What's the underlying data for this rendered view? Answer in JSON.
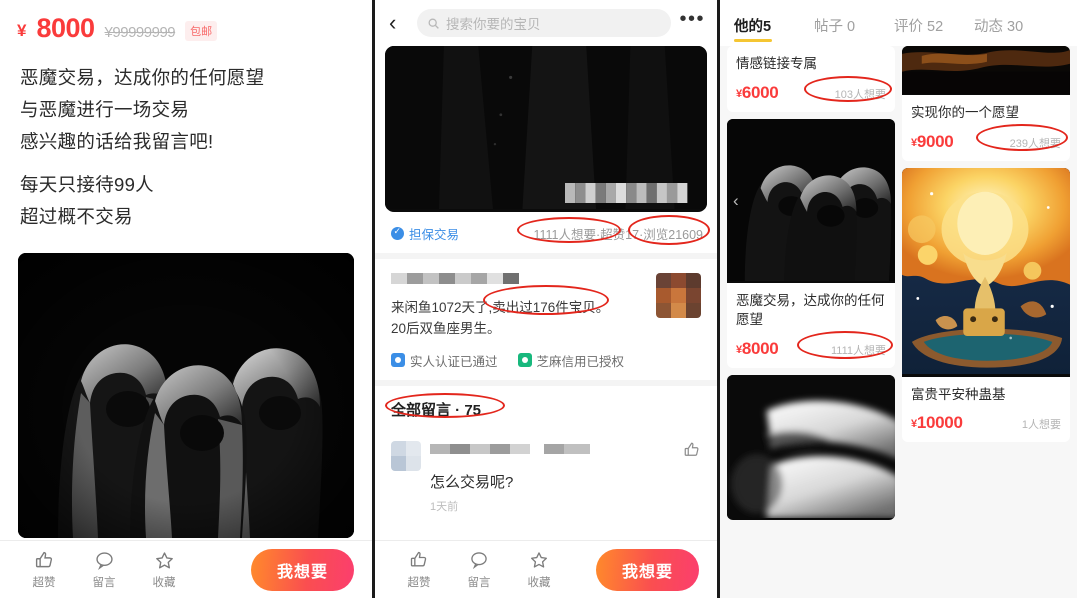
{
  "left_panel": {
    "price": {
      "currency": "¥",
      "value": "8000",
      "original": "¥99999999",
      "shipping_badge": "包邮"
    },
    "description_lines": [
      "恶魔交易，达成你的任何愿望",
      "与恶魔进行一场交易",
      "感兴趣的话给我留言吧!",
      "每天只接待99人",
      "超过概不交易"
    ],
    "hero_image_alt": "三个黑袍兜帽人像",
    "bottom_bar": {
      "items": [
        {
          "icon": "thumbs-up-icon",
          "label": "超赞"
        },
        {
          "icon": "comment-icon",
          "label": "留言"
        },
        {
          "icon": "star-icon",
          "label": "收藏"
        }
      ],
      "cta_label": "我想要"
    }
  },
  "mid_panel": {
    "header": {
      "back_icon": "chevron-left-icon",
      "search_placeholder": "搜索你要的宝贝",
      "search_icon": "search-icon",
      "more_icon": "ellipsis-icon"
    },
    "product_image_alt": "暗色商品图（底部马赛克）",
    "guarantee": {
      "icon": "shield-check-icon",
      "label": "担保交易"
    },
    "stats_text": "1111人想要·超赞17·浏览21609",
    "stats": {
      "want": "1111人想要",
      "likes": "超赞17",
      "views": "浏览21609"
    },
    "seller": {
      "name_redacted": true,
      "bio": "来闲鱼1072天了,卖出过176件宝贝。20后双鱼座男生。",
      "verifications": [
        {
          "icon": "id-verified-icon",
          "label": "实人认证已通过",
          "color": "#3b8ee6"
        },
        {
          "icon": "zhima-credit-icon",
          "label": "芝麻信用已授权",
          "color": "#18b87d"
        }
      ]
    },
    "comments_header": "全部留言 · 75",
    "comment": {
      "text": "怎么交易呢?",
      "time": "1天前",
      "like_icon": "thumbs-up-icon"
    },
    "bottom_bar": {
      "items": [
        {
          "icon": "thumbs-up-icon",
          "label": "超赞"
        },
        {
          "icon": "comment-icon",
          "label": "留言"
        },
        {
          "icon": "star-icon",
          "label": "收藏"
        }
      ],
      "cta_label": "我想要"
    }
  },
  "right_panel": {
    "tabs": [
      {
        "label": "他的5",
        "active": true
      },
      {
        "label": "帖子 0",
        "active": false
      },
      {
        "label": "评价 52",
        "active": false
      },
      {
        "label": "动态 30",
        "active": false
      }
    ],
    "cards_left": [
      {
        "title": "情感链接专属",
        "currency": "¥",
        "price": "6000",
        "want": "103人想要",
        "circled": true,
        "image": "none"
      },
      {
        "title": "恶魔交易，达成你的任何愿望",
        "currency": "¥",
        "price": "8000",
        "want": "1111人想要",
        "circled": true,
        "image": "hooded-figures",
        "has_chevron": true
      },
      {
        "title": "",
        "currency": "",
        "price": "",
        "want": "",
        "circled": false,
        "image": "blurred-bw"
      }
    ],
    "cards_right": [
      {
        "title": "实现你的一个愿望",
        "currency": "¥",
        "price": "9000",
        "want": "239人想要",
        "circled": true,
        "image": "dark-fire"
      },
      {
        "title": "富贵平安种蛊基",
        "currency": "¥",
        "price": "10000",
        "want": "1人想要",
        "circled": false,
        "image": "orange-illustration"
      }
    ]
  },
  "colors": {
    "price_red": "#fa3b3b",
    "annotation_red": "#e3261c",
    "tab_underline": "#f5c633",
    "cta_gradient_start": "#ff8a2b",
    "cta_gradient_end": "#fb3e6e",
    "link_blue": "#3b8ee6",
    "credit_green": "#18b87d"
  }
}
